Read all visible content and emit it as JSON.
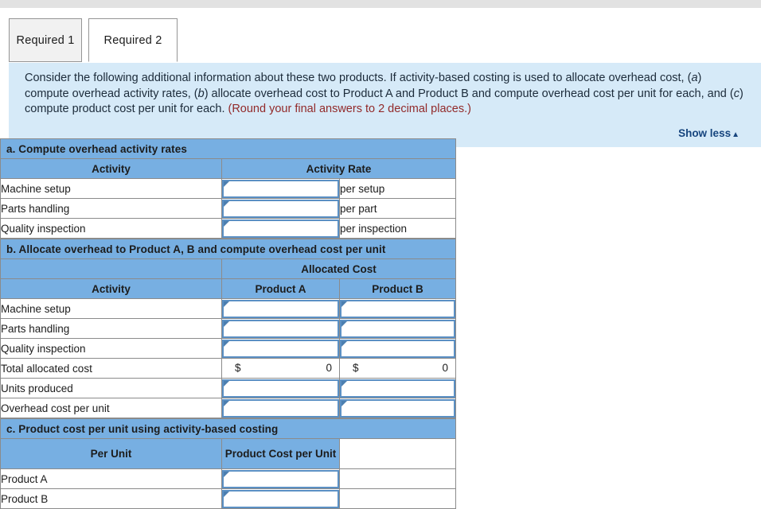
{
  "tabs": [
    {
      "label": "Required 1",
      "active": false
    },
    {
      "label": "Required 2",
      "active": true
    }
  ],
  "instructions": {
    "line1_a": "Consider the following additional information about these two products. If activity-based costing is used to allocate overhead cost, (",
    "italic_a": "a",
    "line1_b": ") compute overhead activity rates, (",
    "italic_b": "b",
    "line1_c": ") allocate overhead cost to Product A and Product B and compute overhead cost per unit for each, and (",
    "italic_c": "c",
    "line1_d": ") compute product cost per unit for each. ",
    "round_note": "(Round your final answers to 2 decimal places.)",
    "show_less_label": "Show less",
    "show_less_caret": "▲"
  },
  "section_a": {
    "header": "a. Compute overhead activity rates",
    "col_activity": "Activity",
    "col_rate": "Activity Rate",
    "rows": [
      {
        "activity": "Machine setup",
        "rate": "",
        "unit": "per setup"
      },
      {
        "activity": "Parts handling",
        "rate": "",
        "unit": "per part"
      },
      {
        "activity": "Quality inspection",
        "rate": "",
        "unit": "per inspection"
      }
    ]
  },
  "section_b": {
    "header": "b. Allocate overhead to Product A, B and compute overhead cost per unit",
    "col_allocated": "Allocated Cost",
    "col_activity": "Activity",
    "col_product_a": "Product A",
    "col_product_b": "Product B",
    "rows": [
      {
        "label": "Machine setup",
        "a": "",
        "b": "",
        "type": "input"
      },
      {
        "label": "Parts handling",
        "a": "",
        "b": "",
        "type": "input"
      },
      {
        "label": "Quality inspection",
        "a": "",
        "b": "",
        "type": "input"
      }
    ],
    "total_row": {
      "label": "Total allocated cost",
      "a_symbol": "$",
      "a_value": "0",
      "b_symbol": "$",
      "b_value": "0"
    },
    "units_row": {
      "label": "Units produced",
      "a": "",
      "b": ""
    },
    "per_unit_row": {
      "label": "Overhead cost per unit",
      "a": "",
      "b": ""
    }
  },
  "section_c": {
    "header": "c. Product cost per unit using activity-based costing",
    "col_per_unit": "Per Unit",
    "col_product_cost": "Product Cost per Unit",
    "rows": [
      {
        "label": "Product A",
        "value": ""
      },
      {
        "label": "Product B",
        "value": ""
      }
    ]
  },
  "colors": {
    "header_blue": "#77afe2",
    "panel_blue": "#d6eaf8",
    "input_border": "#5b90c4",
    "link_navy": "#17457e",
    "note_red": "#922a2a"
  }
}
